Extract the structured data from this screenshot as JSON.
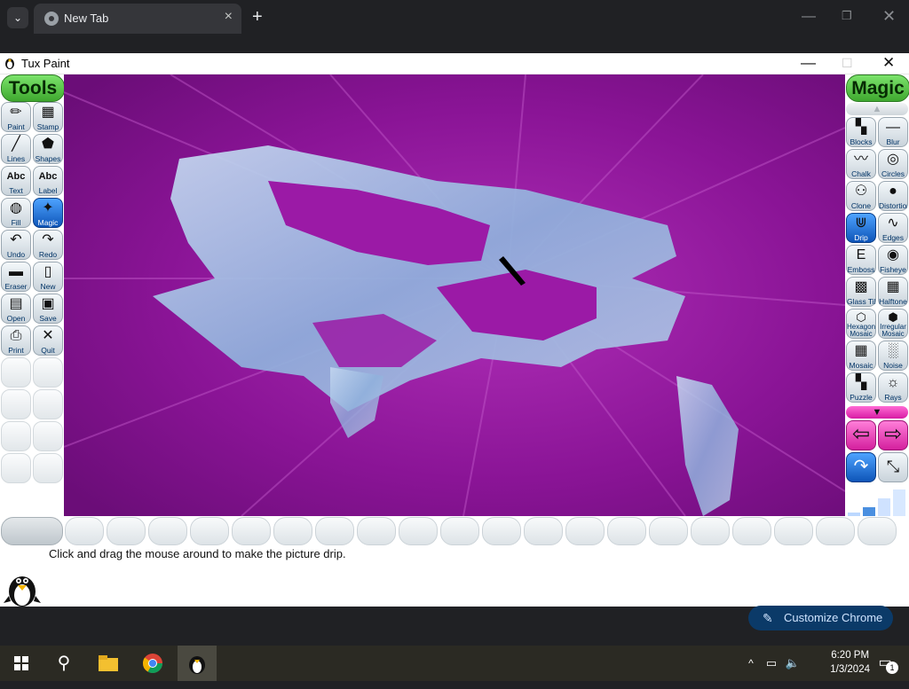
{
  "chrome": {
    "tab_title": "New Tab",
    "customize_label": "Customize Chrome"
  },
  "window": {
    "title": "Tux Paint"
  },
  "tools_panel": {
    "header": "Tools",
    "items": [
      {
        "label": "Paint",
        "icon": "✏"
      },
      {
        "label": "Stamp",
        "icon": "▦"
      },
      {
        "label": "Lines",
        "icon": "╱"
      },
      {
        "label": "Shapes",
        "icon": "⬟"
      },
      {
        "label": "Text",
        "icon": "Abc"
      },
      {
        "label": "Label",
        "icon": "Abc"
      },
      {
        "label": "Fill",
        "icon": "◍"
      },
      {
        "label": "Magic",
        "icon": "✦"
      },
      {
        "label": "Undo",
        "icon": "↶"
      },
      {
        "label": "Redo",
        "icon": "↷"
      },
      {
        "label": "Eraser",
        "icon": "▬"
      },
      {
        "label": "New",
        "icon": "▯"
      },
      {
        "label": "Open",
        "icon": "▤"
      },
      {
        "label": "Save",
        "icon": "▣"
      },
      {
        "label": "Print",
        "icon": "⎙"
      },
      {
        "label": "Quit",
        "icon": "✕"
      }
    ]
  },
  "magic_panel": {
    "header": "Magic",
    "items": [
      {
        "label": "Blocks",
        "icon": "▚"
      },
      {
        "label": "Blur",
        "icon": "—"
      },
      {
        "label": "Chalk",
        "icon": "〰"
      },
      {
        "label": "Circles",
        "icon": "◎"
      },
      {
        "label": "Clone",
        "icon": "⚇"
      },
      {
        "label": "Distortion",
        "icon": "●"
      },
      {
        "label": "Drip",
        "icon": "⋓"
      },
      {
        "label": "Edges",
        "icon": "∿"
      },
      {
        "label": "Emboss",
        "icon": "E"
      },
      {
        "label": "Fisheye",
        "icon": "◉"
      },
      {
        "label": "Glass Tile",
        "icon": "▩"
      },
      {
        "label": "Halftone",
        "icon": "▦"
      },
      {
        "label": "Hexagon Mosaic",
        "icon": "⬡"
      },
      {
        "label": "Irregular Mosaic",
        "icon": "⬢"
      },
      {
        "label": "Mosaic",
        "icon": "▦"
      },
      {
        "label": "Noise",
        "icon": "░"
      },
      {
        "label": "Puzzle",
        "icon": "▚"
      },
      {
        "label": "Rays",
        "icon": "☼"
      }
    ]
  },
  "status_text": "Click and drag the mouse around to make the picture drip.",
  "clock": {
    "time": "6:20 PM",
    "date": "1/3/2024"
  },
  "notification_count": "1",
  "colors": {
    "canvas_magenta": "#8a1496",
    "canvas_blob": "#9fc0e6",
    "selected_blue": "#1a6fd8",
    "magic_header_green": "#5ccf4c"
  }
}
